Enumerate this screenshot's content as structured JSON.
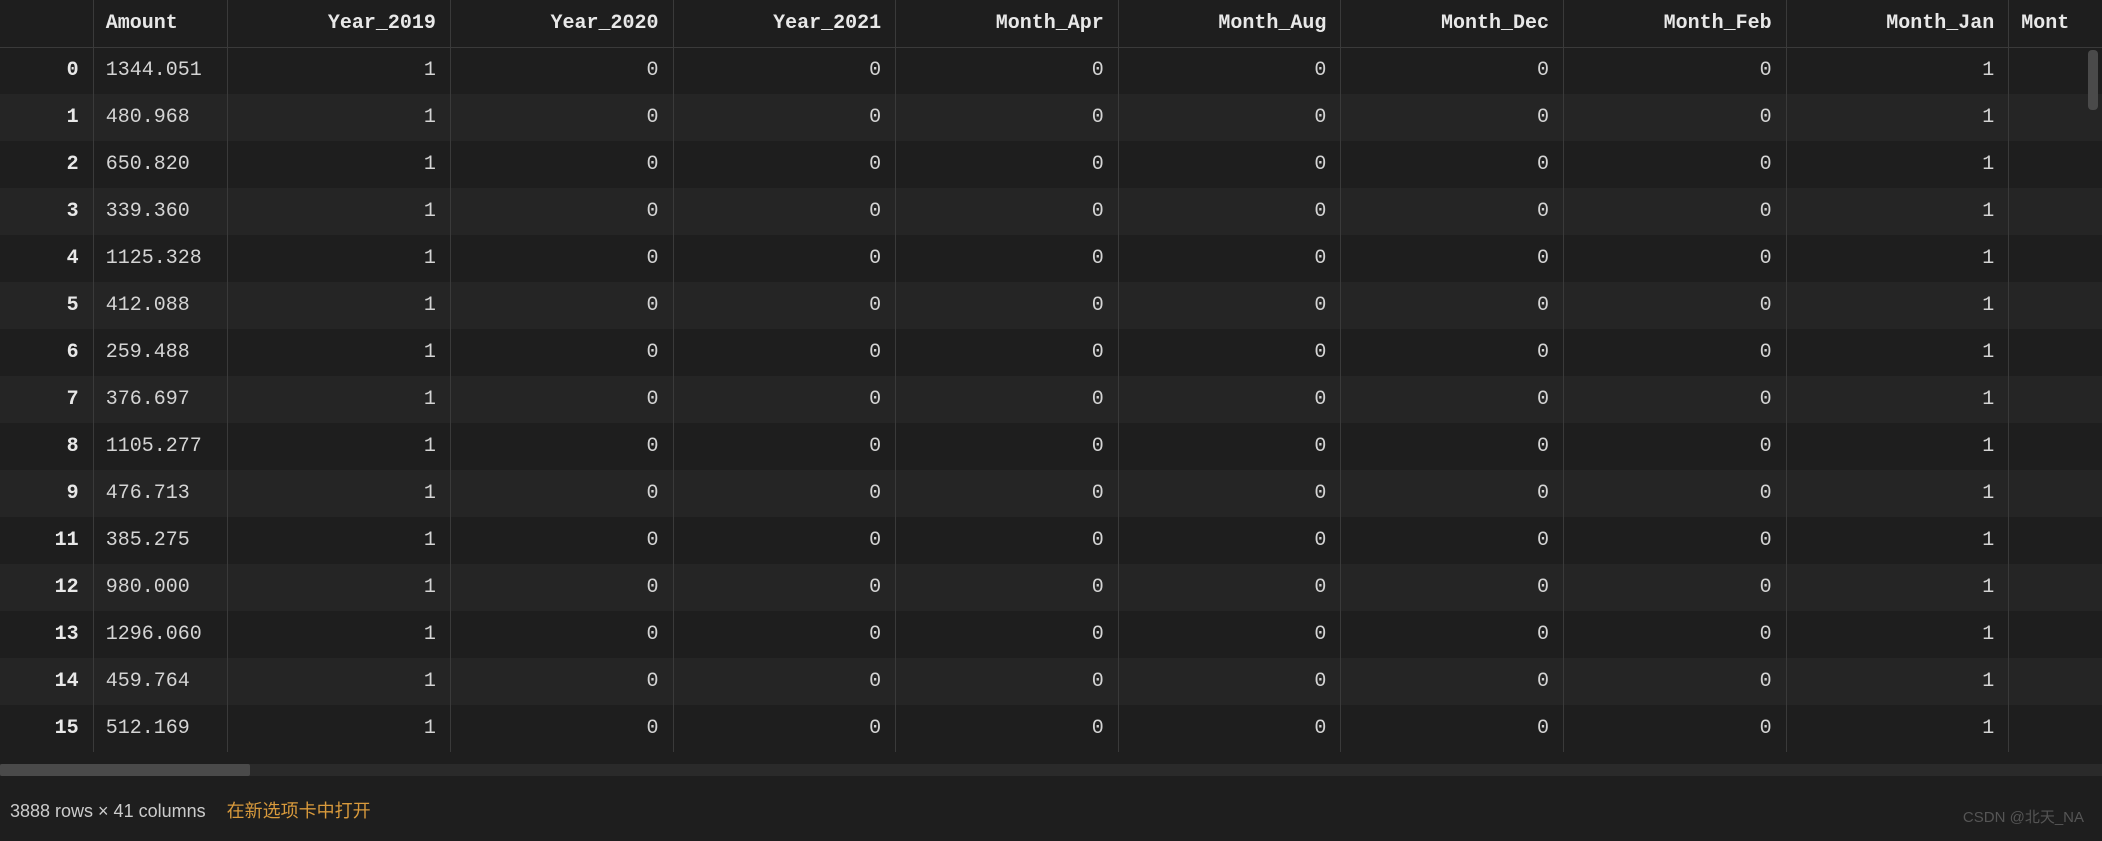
{
  "table": {
    "columns": [
      "Amount",
      "Year_2019",
      "Year_2020",
      "Year_2021",
      "Month_Apr",
      "Month_Aug",
      "Month_Dec",
      "Month_Feb",
      "Month_Jan",
      "Mont"
    ],
    "rows": [
      {
        "idx": "0",
        "amount": "1344.051",
        "y2019": "1",
        "y2020": "0",
        "y2021": "0",
        "apr": "0",
        "aug": "0",
        "dec": "0",
        "feb": "0",
        "jan": "1"
      },
      {
        "idx": "1",
        "amount": "480.968",
        "y2019": "1",
        "y2020": "0",
        "y2021": "0",
        "apr": "0",
        "aug": "0",
        "dec": "0",
        "feb": "0",
        "jan": "1"
      },
      {
        "idx": "2",
        "amount": "650.820",
        "y2019": "1",
        "y2020": "0",
        "y2021": "0",
        "apr": "0",
        "aug": "0",
        "dec": "0",
        "feb": "0",
        "jan": "1"
      },
      {
        "idx": "3",
        "amount": "339.360",
        "y2019": "1",
        "y2020": "0",
        "y2021": "0",
        "apr": "0",
        "aug": "0",
        "dec": "0",
        "feb": "0",
        "jan": "1"
      },
      {
        "idx": "4",
        "amount": "1125.328",
        "y2019": "1",
        "y2020": "0",
        "y2021": "0",
        "apr": "0",
        "aug": "0",
        "dec": "0",
        "feb": "0",
        "jan": "1"
      },
      {
        "idx": "5",
        "amount": "412.088",
        "y2019": "1",
        "y2020": "0",
        "y2021": "0",
        "apr": "0",
        "aug": "0",
        "dec": "0",
        "feb": "0",
        "jan": "1"
      },
      {
        "idx": "6",
        "amount": "259.488",
        "y2019": "1",
        "y2020": "0",
        "y2021": "0",
        "apr": "0",
        "aug": "0",
        "dec": "0",
        "feb": "0",
        "jan": "1"
      },
      {
        "idx": "7",
        "amount": "376.697",
        "y2019": "1",
        "y2020": "0",
        "y2021": "0",
        "apr": "0",
        "aug": "0",
        "dec": "0",
        "feb": "0",
        "jan": "1"
      },
      {
        "idx": "8",
        "amount": "1105.277",
        "y2019": "1",
        "y2020": "0",
        "y2021": "0",
        "apr": "0",
        "aug": "0",
        "dec": "0",
        "feb": "0",
        "jan": "1"
      },
      {
        "idx": "9",
        "amount": "476.713",
        "y2019": "1",
        "y2020": "0",
        "y2021": "0",
        "apr": "0",
        "aug": "0",
        "dec": "0",
        "feb": "0",
        "jan": "1"
      },
      {
        "idx": "11",
        "amount": "385.275",
        "y2019": "1",
        "y2020": "0",
        "y2021": "0",
        "apr": "0",
        "aug": "0",
        "dec": "0",
        "feb": "0",
        "jan": "1"
      },
      {
        "idx": "12",
        "amount": "980.000",
        "y2019": "1",
        "y2020": "0",
        "y2021": "0",
        "apr": "0",
        "aug": "0",
        "dec": "0",
        "feb": "0",
        "jan": "1"
      },
      {
        "idx": "13",
        "amount": "1296.060",
        "y2019": "1",
        "y2020": "0",
        "y2021": "0",
        "apr": "0",
        "aug": "0",
        "dec": "0",
        "feb": "0",
        "jan": "1"
      },
      {
        "idx": "14",
        "amount": "459.764",
        "y2019": "1",
        "y2020": "0",
        "y2021": "0",
        "apr": "0",
        "aug": "0",
        "dec": "0",
        "feb": "0",
        "jan": "1"
      },
      {
        "idx": "15",
        "amount": "512.169",
        "y2019": "1",
        "y2020": "0",
        "y2021": "0",
        "apr": "0",
        "aug": "0",
        "dec": "0",
        "feb": "0",
        "jan": "1"
      }
    ]
  },
  "footer": {
    "shape_text": "3888 rows × 41 columns",
    "link_text": "在新选项卡中打开"
  },
  "watermark": "CSDN @北天_NA"
}
